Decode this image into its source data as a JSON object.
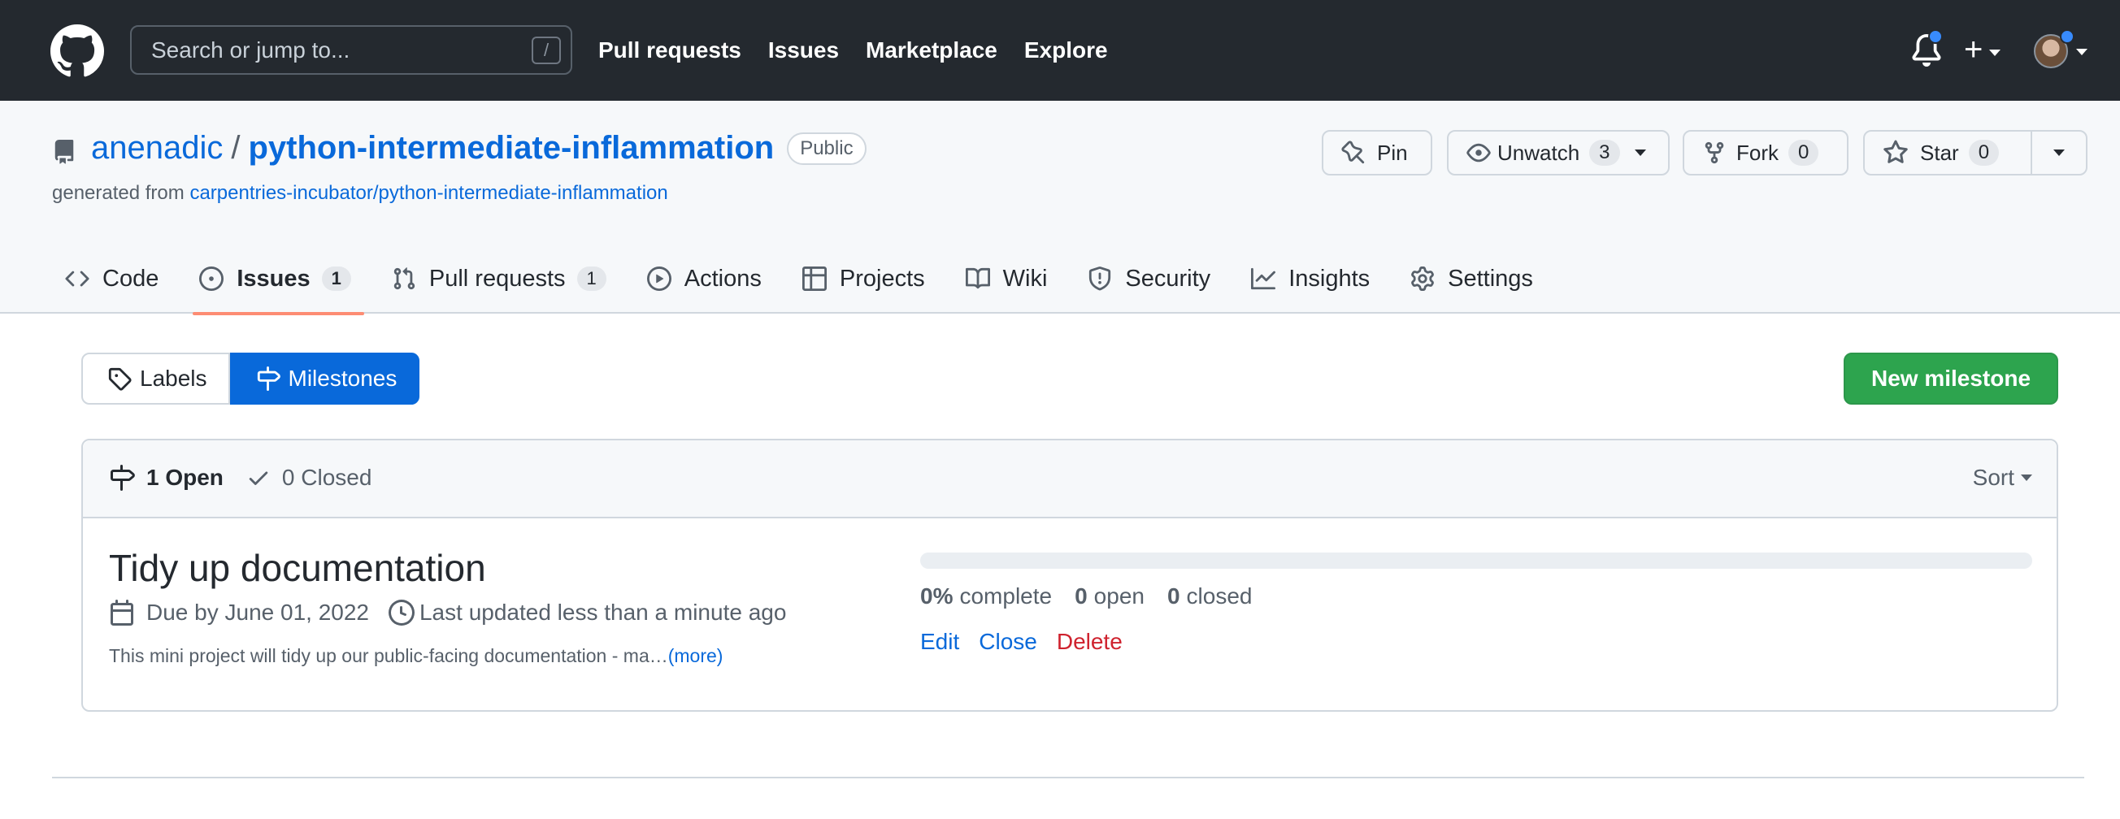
{
  "header": {
    "search_placeholder": "Search or jump to...",
    "search_shortcut": "/",
    "nav": [
      "Pull requests",
      "Issues",
      "Marketplace",
      "Explore"
    ],
    "icons": [
      "github-logo-icon",
      "bell-icon",
      "plus-icon",
      "avatar"
    ]
  },
  "repo": {
    "owner": "anenadic",
    "separator": "/",
    "name": "python-intermediate-inflammation",
    "visibility": "Public",
    "generated_prefix": "generated from",
    "generated_link": "carpentries-incubator/python-intermediate-inflammation",
    "buttons": {
      "pin": "Pin",
      "unwatch": "Unwatch",
      "unwatch_count": "3",
      "fork": "Fork",
      "fork_count": "0",
      "star": "Star",
      "star_count": "0"
    },
    "tabs": [
      {
        "label": "Code",
        "count": ""
      },
      {
        "label": "Issues",
        "count": "1"
      },
      {
        "label": "Pull requests",
        "count": "1"
      },
      {
        "label": "Actions",
        "count": ""
      },
      {
        "label": "Projects",
        "count": ""
      },
      {
        "label": "Wiki",
        "count": ""
      },
      {
        "label": "Security",
        "count": ""
      },
      {
        "label": "Insights",
        "count": ""
      },
      {
        "label": "Settings",
        "count": ""
      }
    ]
  },
  "subnav": {
    "labels": "Labels",
    "milestones": "Milestones",
    "new_milestone": "New milestone"
  },
  "milestones_list": {
    "open_label": "1 Open",
    "closed_label": "0 Closed",
    "sort_label": "Sort",
    "items": [
      {
        "title": "Tidy up documentation",
        "due": "Due by June 01, 2022",
        "updated": "Last updated less than a minute ago",
        "description": "This mini project will tidy up our public-facing documentation - ma…",
        "more": "(more)",
        "progress_percent": 0,
        "complete_value": "0%",
        "complete_label": "complete",
        "open_value": "0",
        "open_label": "open",
        "closed_value": "0",
        "closed_label": "closed",
        "actions": {
          "edit": "Edit",
          "close": "Close",
          "delete": "Delete"
        }
      }
    ]
  },
  "colors": {
    "header_bg": "#24292f",
    "link": "#0969da",
    "primary_button": "#2da44e",
    "danger": "#cf222e",
    "active_tab_underline": "#fd8c73"
  }
}
